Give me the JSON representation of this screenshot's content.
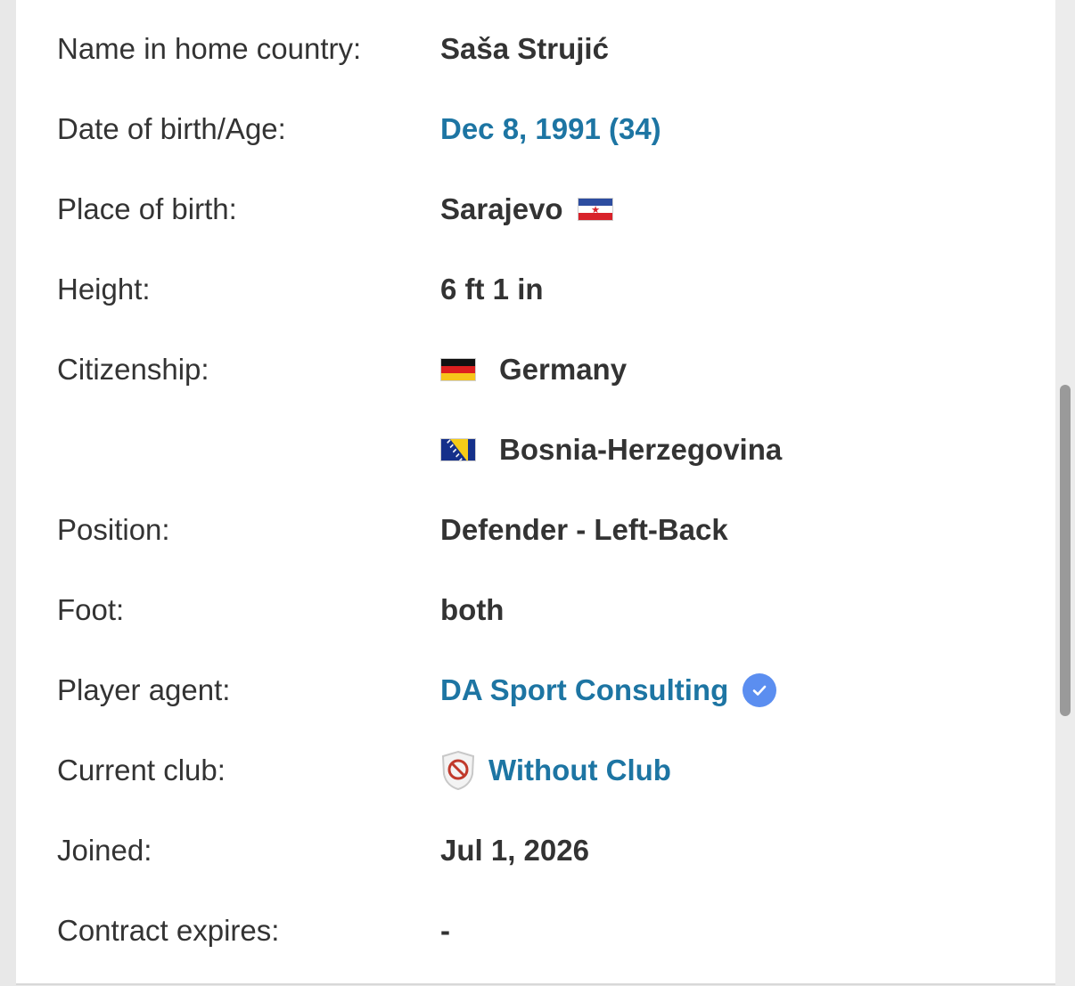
{
  "profile": {
    "name_home": {
      "label": "Name in home country:",
      "value": "Saša Strujić"
    },
    "dob": {
      "label": "Date of birth/Age:",
      "value": "Dec 8, 1991 (34)"
    },
    "birthplace": {
      "label": "Place of birth:",
      "value": "Sarajevo",
      "flag_icon": "yugoslavia-flag-icon"
    },
    "height": {
      "label": "Height:",
      "value": "6 ft 1 in"
    },
    "citizenship": {
      "label": "Citizenship:",
      "items": [
        {
          "value": "Germany",
          "flag_icon": "germany-flag-icon"
        },
        {
          "value": "Bosnia-Herzegovina",
          "flag_icon": "bosnia-herzegovina-flag-icon"
        }
      ]
    },
    "position": {
      "label": "Position:",
      "value": "Defender - Left-Back"
    },
    "foot": {
      "label": "Foot:",
      "value": "both"
    },
    "agent": {
      "label": "Player agent:",
      "value": "DA Sport Consulting",
      "badge_icon": "verified-check-icon"
    },
    "club": {
      "label": "Current club:",
      "value": "Without Club",
      "crest_icon": "no-club-crest-icon"
    },
    "joined": {
      "label": "Joined:",
      "value": "Jul 1, 2026"
    },
    "contract": {
      "label": "Contract expires:",
      "value": "-"
    }
  },
  "colors": {
    "text": "#333333",
    "link": "#1d75a3",
    "verified": "#5b8ef0",
    "background": "#ffffff",
    "page_gutter": "#e8e8e8"
  }
}
